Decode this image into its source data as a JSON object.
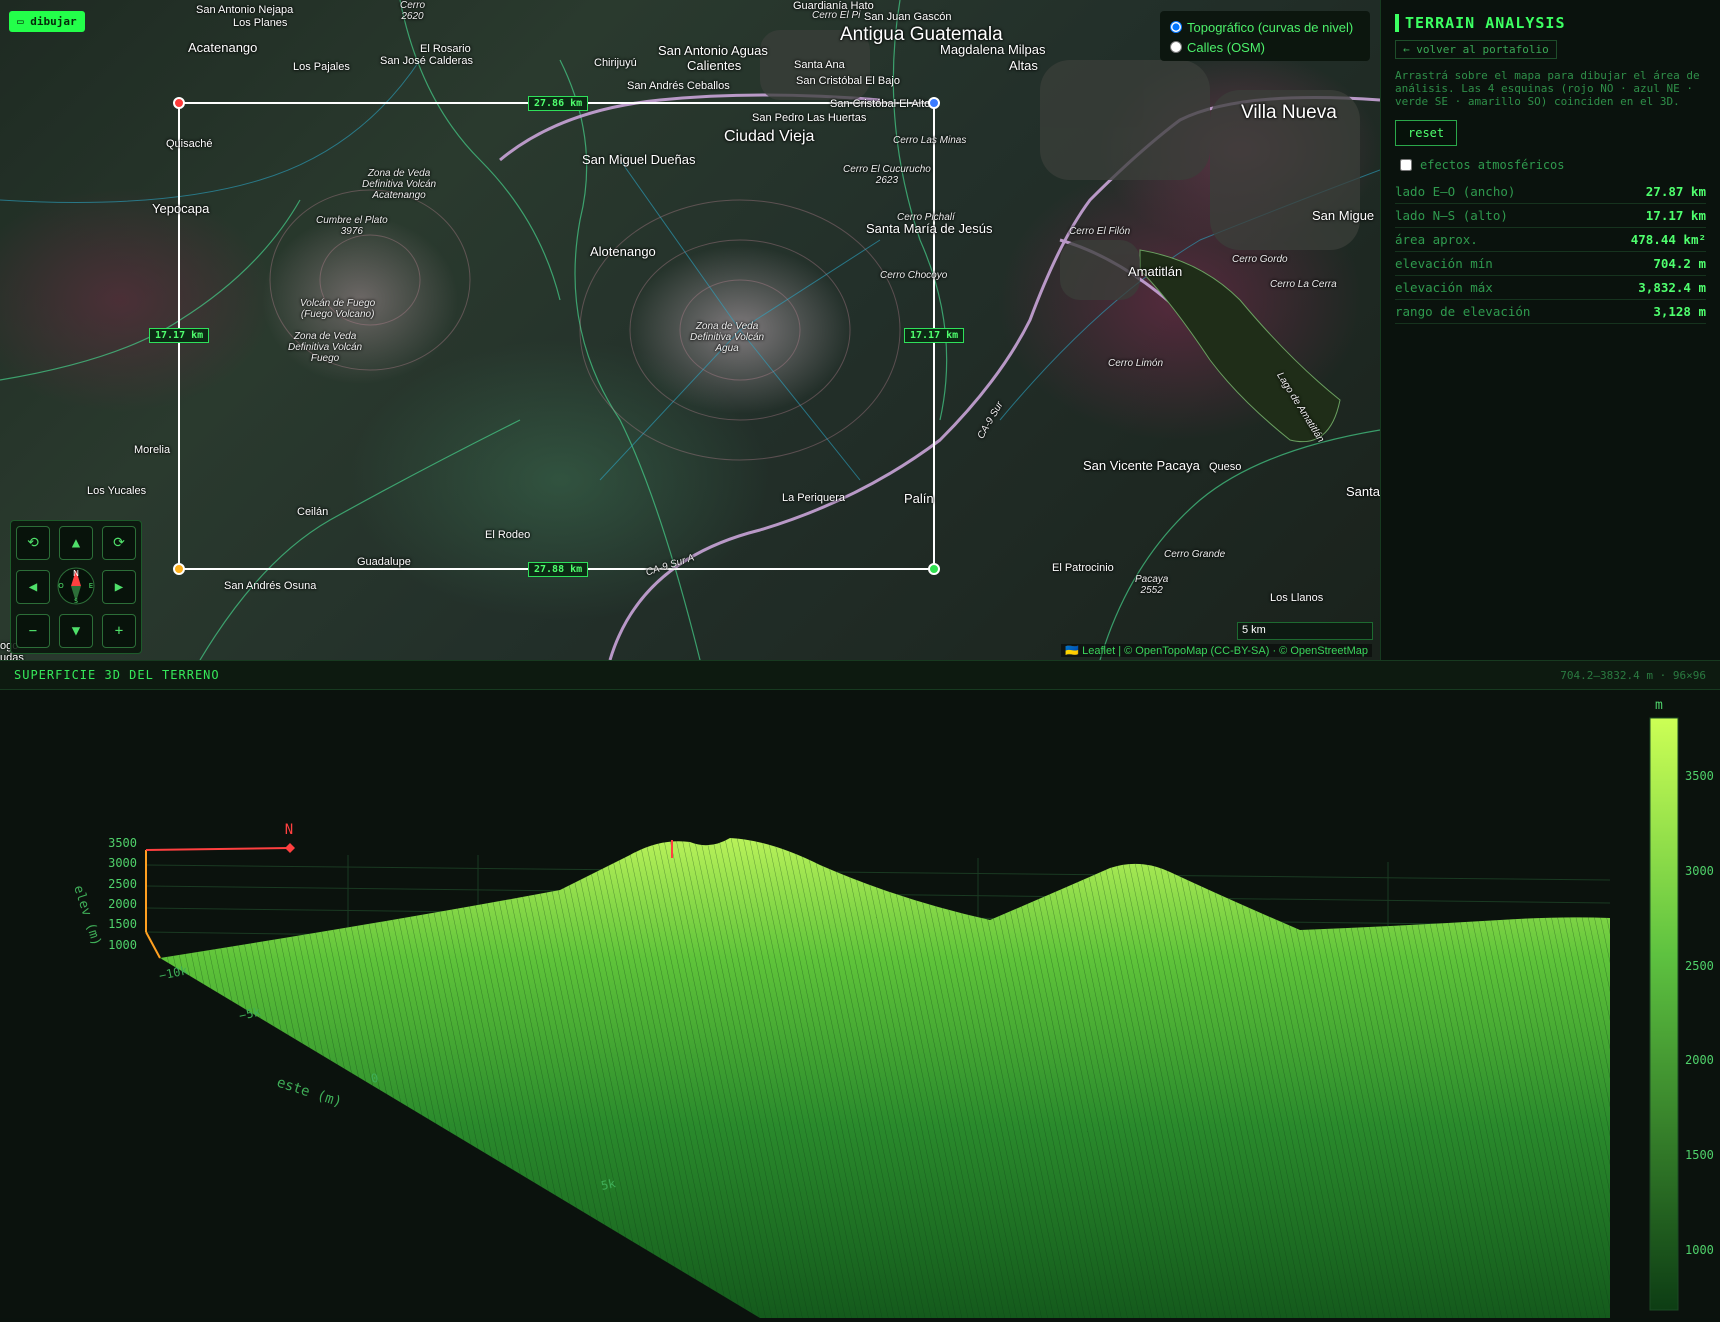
{
  "map": {
    "draw_button": "▭ dibujar",
    "layers": [
      {
        "label": "Topográfico (curvas de nivel)",
        "checked": true
      },
      {
        "label": "Calles (OSM)",
        "checked": false
      }
    ],
    "dimension_labels": {
      "top": "27.86 km",
      "bottom": "27.88 km",
      "left": "17.17 km",
      "right": "17.17 km"
    },
    "scale": "5 km",
    "attribution": "🇺🇦 Leaflet | © OpenTopoMap (CC-BY-SA) · © OpenStreetMap",
    "nav": {
      "rotate_left": "⟲",
      "up": "▲",
      "rotate_right": "⟳",
      "left": "◀",
      "right": "▶",
      "zoom_out": "−",
      "down": "▼",
      "zoom_in": "+",
      "compass_n": "N",
      "compass_s": "S",
      "compass_e": "E",
      "compass_w": "O"
    },
    "places": {
      "antigua": "Antigua Guatemala",
      "villa_nueva": "Villa Nueva",
      "ciudad_vieja": "Ciudad Vieja",
      "san_miguel_duenas": "San Miguel Dueñas",
      "alotenango": "Alotenango",
      "santa_maria_jesus": "Santa María de Jesús",
      "amatitlan": "Amatitlán",
      "san_vicente_pacaya": "San Vicente Pacaya",
      "acatenango": "Acatenango",
      "yepocapa": "Yepocapa",
      "san_antonio_aguas": "San Antonio Aguas",
      "calientes": "Calientes",
      "magdalena": "Magdalena Milpas",
      "altas": "Altas",
      "san_miguel": "San Migue",
      "santa": "Santa",
      "palin": "Palín",
      "la_periquera": "La Periquera",
      "el_rodeo": "El Rodeo",
      "guadalupe": "Guadalupe",
      "san_andres_osuna": "San Andrés Osuna",
      "ceilan": "Ceilán",
      "morelia": "Morelia",
      "los_yucales": "Los Yucales",
      "quisache": "Quisaché",
      "los_pajales": "Los Pajales",
      "el_rosario": "El Rosario",
      "san_jose_calderas": "San José Calderas",
      "chirijuyu": "Chirijuyú",
      "santa_ana": "Santa Ana",
      "san_cristobal_bajo": "San Cristóbal El Bajo",
      "san_andres_ceballos": "San Andrés Ceballos",
      "san_pedro_huertas": "San Pedro Las Huertas",
      "san_cristobal_alto": "San Cristóbal El Alto",
      "san_antonio_nejapa": "San Antonio Nejapa",
      "los_planes": "Los Planes",
      "guardiania_hato": "Guardianía Hato",
      "san_juan_gascon": "San Juan Gascón",
      "el_patrocinio": "El Patrocinio",
      "los_llanos": "Los Llanos",
      "queso": "Queso",
      "cerro_las_minas": "Cerro Las Minas",
      "cerro_cucurucho": "Cerro El Cucurucho\n2623",
      "cerro_pichali": "Cerro Pichalí",
      "cerro_chocoyo": "Cerro Chocoyo",
      "cerro_filon": "Cerro El Filón",
      "cerro_gordo": "Cerro Gordo",
      "cerro_la_cerra": "Cerro La Cerra",
      "cerro_limon": "Cerro Limón",
      "cerro_grande": "Cerro Grande",
      "pacaya": "Pacaya\n2552",
      "cumbre_plato": "Cumbre el Plato\n3976",
      "volcan_fuego": "Volcán de Fuego\n(Fuego Volcano)",
      "veda_acatenango": "Zona de Veda\nDefinitiva Volcán\nAcatenango",
      "veda_fuego": "Zona de Veda\nDefinitiva Volcán\nFuego",
      "veda_agua": "Zona de Veda\nDefinitiva Volcán\nAgua",
      "ca9sur": "CA-9 Sur",
      "ca9sura": "CA-9 Sur A",
      "lago": "Lago de Amatitlán",
      "cerro_2620": "Cerro\n2620",
      "el_pi": "Cerro El Pi",
      "ogo": "ogo",
      "udas": "udas"
    }
  },
  "panel": {
    "title": "TERRAIN ANALYSIS",
    "back_link": "← volver al portafolio",
    "instructions": "Arrastrá sobre el mapa para dibujar el área de análisis. Las 4 esquinas (rojo NO · azul NE · verde SE · amarillo SO) coinciden en el 3D.",
    "reset": "reset",
    "atmospheric": "efectos atmosféricos",
    "stats": [
      {
        "label": "lado E–O (ancho)",
        "value": "27.87 km"
      },
      {
        "label": "lado N–S (alto)",
        "value": "17.17 km"
      },
      {
        "label": "área aprox.",
        "value": "478.44 km²"
      },
      {
        "label": "elevación mín",
        "value": "704.2 m"
      },
      {
        "label": "elevación máx",
        "value": "3,832.4 m"
      },
      {
        "label": "rango de elevación",
        "value": "3,128 m"
      }
    ]
  },
  "surface": {
    "title": "SUPERFICIE 3D DEL TERRENO",
    "meta": "704.2–3832.4 m · 96×96",
    "north": "N",
    "z_axis_label": "elev (m)",
    "z_ticks": [
      "3500",
      "3000",
      "2500",
      "2000",
      "1500",
      "1000"
    ],
    "x_axis_label": "este (m)",
    "x_ticks": [
      "−10k",
      "−5k",
      "0",
      "5k"
    ],
    "colorbar_unit": "m",
    "colorbar_ticks": [
      "3500",
      "3000",
      "2500",
      "2000",
      "1500",
      "1000"
    ],
    "colors": {
      "accent": "#3cff62",
      "low": "#0d3d14",
      "high": "#ccff55"
    }
  }
}
